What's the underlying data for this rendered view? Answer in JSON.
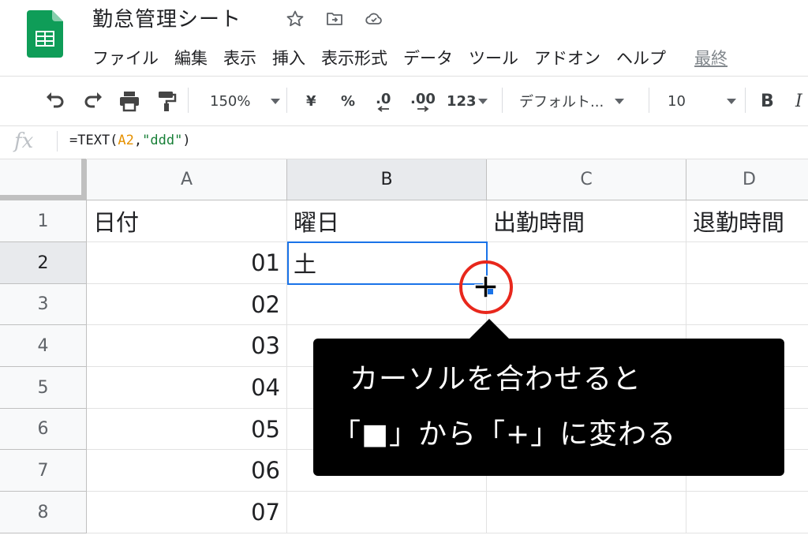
{
  "doc": {
    "title": "勤怠管理シート",
    "icons": [
      "star-icon",
      "move-to-folder-icon",
      "cloud-saved-icon"
    ]
  },
  "menu": {
    "items": [
      "ファイル",
      "編集",
      "表示",
      "挿入",
      "表示形式",
      "データ",
      "ツール",
      "アドオン",
      "ヘルプ"
    ],
    "last_edit": "最終"
  },
  "toolbar": {
    "zoom": "150%",
    "currency": "¥",
    "percent": "%",
    "dec_decrease": ".0",
    "dec_increase": ".00",
    "more_formats": "123",
    "font": "デフォルト...",
    "font_size": "10",
    "bold": "B",
    "italic": "I"
  },
  "formula_bar": {
    "fx": "fx",
    "formula_prefix": "=TEXT(",
    "formula_ref": "A2",
    "formula_sep": ",",
    "formula_str": "\"ddd\"",
    "formula_suffix": ")"
  },
  "sheet": {
    "columns": [
      "A",
      "B",
      "C",
      "D"
    ],
    "rows": [
      "1",
      "2",
      "3",
      "4",
      "5",
      "6",
      "7",
      "8"
    ],
    "cells": {
      "A1": "日付",
      "B1": "曜日",
      "C1": "出勤時間",
      "D1": "退勤時間",
      "A2": "01",
      "B2": "土",
      "A3": "02",
      "A4": "03",
      "A5": "04",
      "A6": "05",
      "A7": "06",
      "A8": "07"
    }
  },
  "annotation": {
    "line1": "カーソルを合わせると",
    "line2": "「■」から「+」に変わる"
  },
  "colors": {
    "selection": "#1a73e8",
    "highlight_circle": "#e8271c",
    "formula_ref": "#e69100",
    "formula_string": "#188038",
    "sheets_green": "#0f9d58"
  }
}
